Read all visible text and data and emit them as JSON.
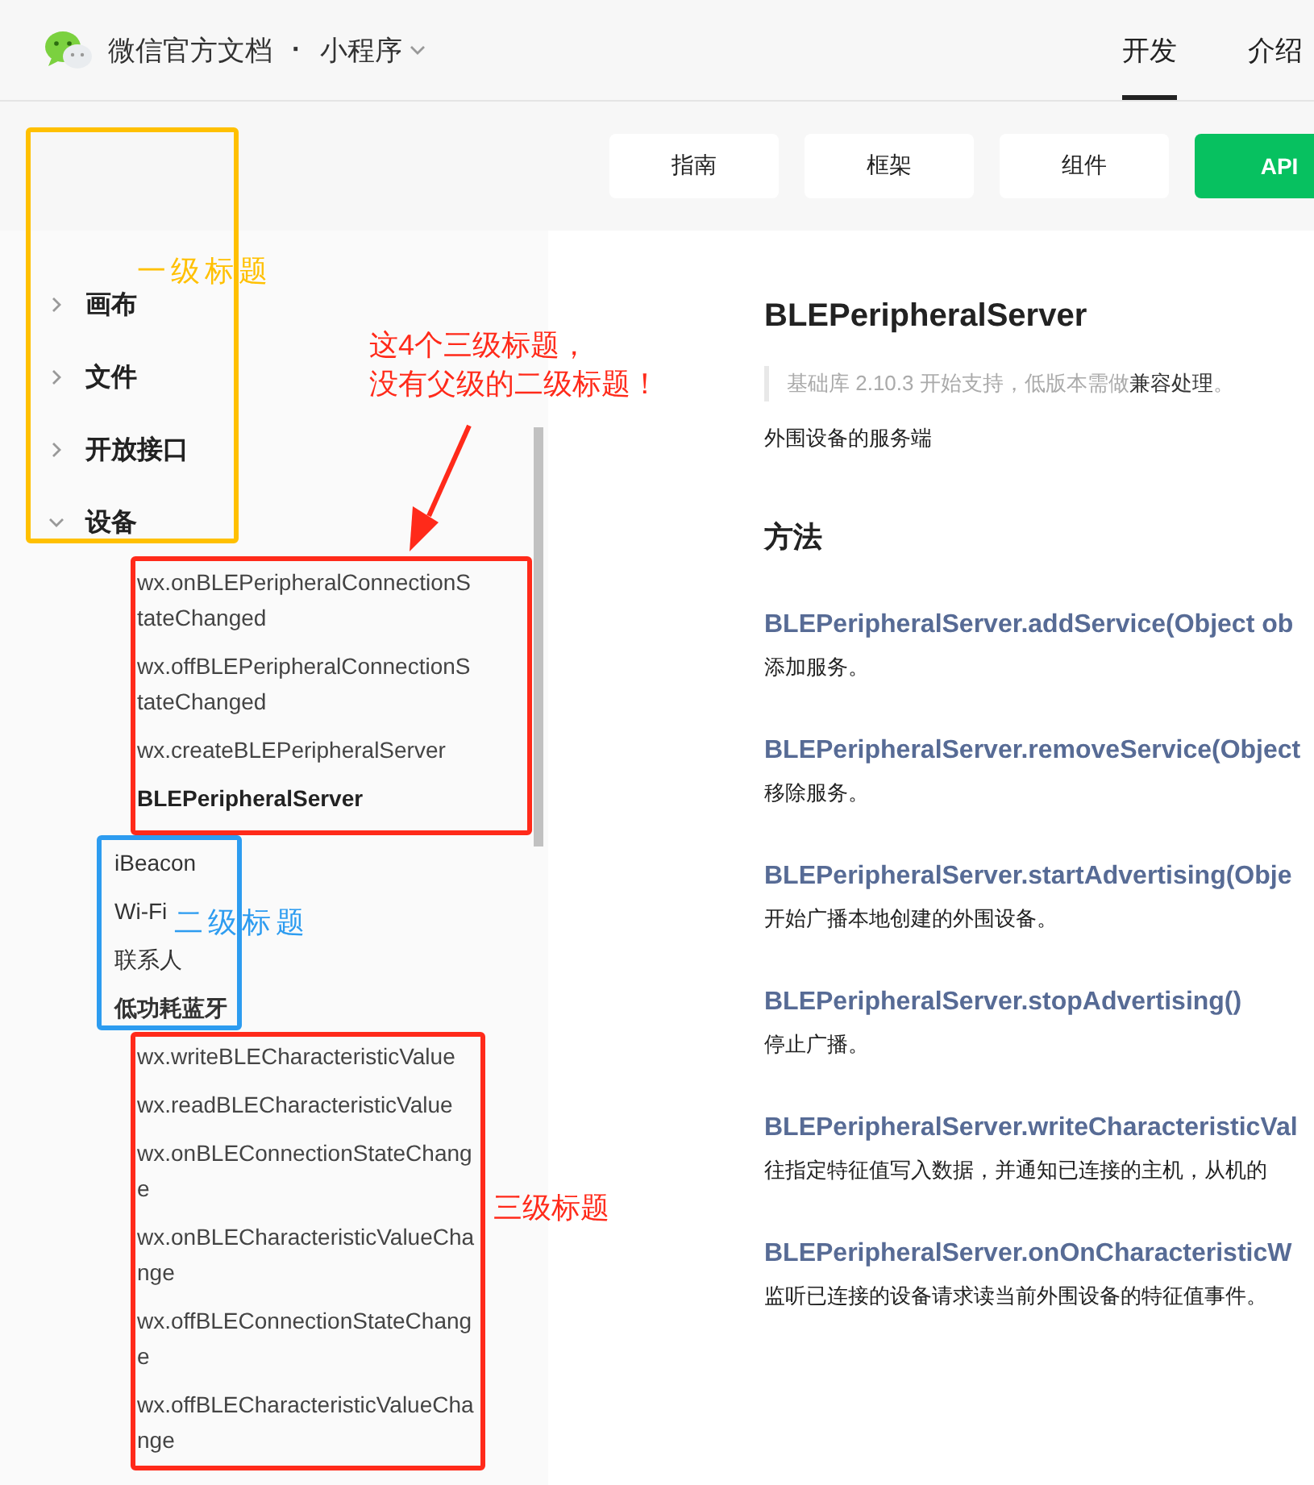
{
  "header": {
    "site_title": "微信官方文档",
    "separator": "·",
    "product": "小程序",
    "nav": [
      {
        "label": "开发",
        "selected": true
      },
      {
        "label": "介绍",
        "selected": false
      }
    ]
  },
  "category_tabs": [
    {
      "label": "指南",
      "selected": false
    },
    {
      "label": "框架",
      "selected": false
    },
    {
      "label": "组件",
      "selected": false
    },
    {
      "label": "API",
      "selected": true
    }
  ],
  "sidebar": {
    "items": [
      {
        "label": "画布",
        "expanded": false
      },
      {
        "label": "文件",
        "expanded": false
      },
      {
        "label": "开放接口",
        "expanded": false
      },
      {
        "label": "设备",
        "expanded": true,
        "children": [
          {
            "kind": "page",
            "label": "wx.onBLEPeripheralConnectionStateChanged",
            "selected": false
          },
          {
            "kind": "page",
            "label": "wx.offBLEPeripheralConnectionStateChanged",
            "selected": false
          },
          {
            "kind": "page",
            "label": "wx.createBLEPeripheralServer",
            "selected": false
          },
          {
            "kind": "page",
            "label": "BLEPeripheralServer",
            "selected": true
          },
          {
            "kind": "group",
            "label": "iBeacon",
            "expanded": false
          },
          {
            "kind": "group",
            "label": "Wi-Fi",
            "expanded": false
          },
          {
            "kind": "group",
            "label": "联系人",
            "expanded": false
          },
          {
            "kind": "group",
            "label": "低功耗蓝牙",
            "expanded": true,
            "children": [
              {
                "kind": "page",
                "label": "wx.writeBLECharacteristicValue",
                "selected": false
              },
              {
                "kind": "page",
                "label": "wx.readBLECharacteristicValue",
                "selected": false
              },
              {
                "kind": "page",
                "label": "wx.onBLEConnectionStateChange",
                "selected": false
              },
              {
                "kind": "page",
                "label": "wx.onBLECharacteristicValueChange",
                "selected": false
              },
              {
                "kind": "page",
                "label": "wx.offBLEConnectionStateChange",
                "selected": false
              },
              {
                "kind": "page",
                "label": "wx.offBLECharacteristicValueChange",
                "selected": false
              }
            ]
          }
        ]
      }
    ]
  },
  "content": {
    "title": "BLEPeripheralServer",
    "note": {
      "text": "基础库 2.10.3 开始支持，低版本需做",
      "link": "兼容处理",
      "after": "。"
    },
    "description": "外围设备的服务端",
    "section": "方法",
    "methods": [
      {
        "name": "BLEPeripheralServer.addService(Object ob",
        "description": "添加服务。"
      },
      {
        "name": "BLEPeripheralServer.removeService(Object",
        "description": "移除服务。"
      },
      {
        "name": "BLEPeripheralServer.startAdvertising(Obje",
        "description": "开始广播本地创建的外围设备。"
      },
      {
        "name": "BLEPeripheralServer.stopAdvertising()",
        "description": "停止广播。"
      },
      {
        "name": "BLEPeripheralServer.writeCharacteristicVal",
        "description": "往指定特征值写入数据，并通知已连接的主机，从机的"
      },
      {
        "name": "BLEPeripheralServer.onOnCharacteristicW",
        "description": "监听已连接的设备请求读当前外围设备的特征值事件。"
      }
    ]
  },
  "annotations": [
    {
      "kind": "box",
      "color": "#ffc000"
    },
    {
      "kind": "label",
      "text": "一级标题",
      "color": "#ffc000"
    },
    {
      "kind": "label",
      "text": "这4个三级标题，",
      "color": "#ff2a1a"
    },
    {
      "kind": "label",
      "text": "没有父级的二级标题！",
      "color": "#ff2a1a"
    },
    {
      "kind": "arrow",
      "color": "#ff2a1a"
    },
    {
      "kind": "box",
      "color": "#ff2a1a"
    },
    {
      "kind": "box",
      "color": "#2d9cf0"
    },
    {
      "kind": "label",
      "text": "二级标题",
      "color": "#2d9cf0"
    },
    {
      "kind": "box",
      "color": "#ff2a1a"
    },
    {
      "kind": "label",
      "text": "三级标题",
      "color": "#ff2a1a"
    }
  ]
}
